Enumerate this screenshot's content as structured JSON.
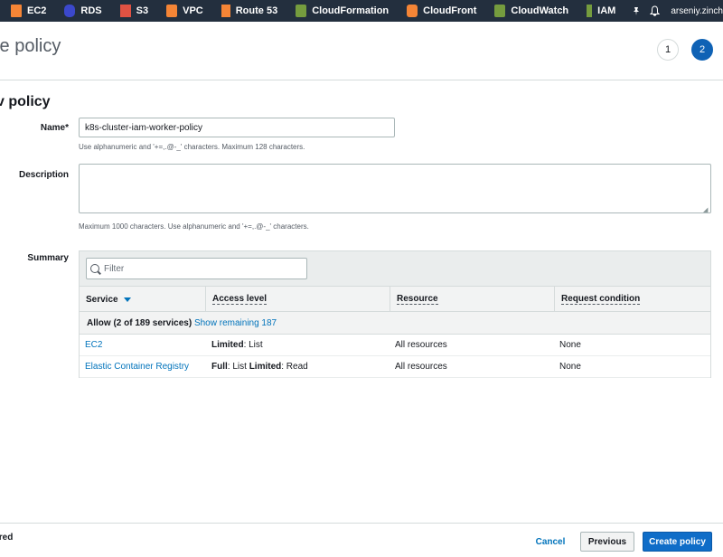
{
  "nav": {
    "items": [
      {
        "label": "EC2",
        "icon": "ec2-icon",
        "color": "#f58536"
      },
      {
        "label": "RDS",
        "icon": "rds-icon",
        "color": "#3b48cc"
      },
      {
        "label": "S3",
        "icon": "s3-icon",
        "color": "#e05243"
      },
      {
        "label": "VPC",
        "icon": "vpc-icon",
        "color": "#f58536"
      },
      {
        "label": "Route 53",
        "icon": "route53-icon",
        "color": "#f58536"
      },
      {
        "label": "CloudFormation",
        "icon": "cloudformation-icon",
        "color": "#759c3e"
      },
      {
        "label": "CloudFront",
        "icon": "cloudfront-icon",
        "color": "#f58536"
      },
      {
        "label": "CloudWatch",
        "icon": "cloudwatch-icon",
        "color": "#759c3e"
      },
      {
        "label": "IAM",
        "icon": "iam-icon",
        "color": "#759c3e"
      }
    ],
    "account": "arseniy.zinche"
  },
  "header": {
    "title": "te policy",
    "steps": [
      "1",
      "2"
    ],
    "active_step": "2"
  },
  "section_title": "v policy",
  "form": {
    "name_label": "Name*",
    "name_value": "k8s-cluster-iam-worker-policy",
    "name_hint": "Use alphanumeric and '+=,.@-_' characters. Maximum 128 characters.",
    "description_label": "Description",
    "description_value": "",
    "description_hint": "Maximum 1000 characters. Use alphanumeric and '+=,.@-_' characters.",
    "summary_label": "Summary"
  },
  "summary": {
    "filter_placeholder": "Filter",
    "columns": [
      "Service",
      "Access level",
      "Resource",
      "Request condition"
    ],
    "group": {
      "text": "Allow (2 of 189 services)",
      "link": "Show remaining 187"
    },
    "rows": [
      {
        "service": "EC2",
        "access_parts": [
          {
            "text": "Limited",
            "bold": true
          },
          {
            "text": ": List",
            "bold": false
          }
        ],
        "resource": "All resources",
        "condition": "None"
      },
      {
        "service": "Elastic Container Registry",
        "access_parts": [
          {
            "text": "Full",
            "bold": true
          },
          {
            "text": ": List ",
            "bold": false
          },
          {
            "text": "Limited",
            "bold": true
          },
          {
            "text": ": Read",
            "bold": false
          }
        ],
        "resource": "All resources",
        "condition": "None"
      }
    ]
  },
  "footer": {
    "required_note": "ired",
    "cancel": "Cancel",
    "previous": "Previous",
    "create": "Create policy"
  },
  "colors": {
    "nav_bg": "#232f3e",
    "primary": "#0f6dc8",
    "link": "#0073bb"
  }
}
